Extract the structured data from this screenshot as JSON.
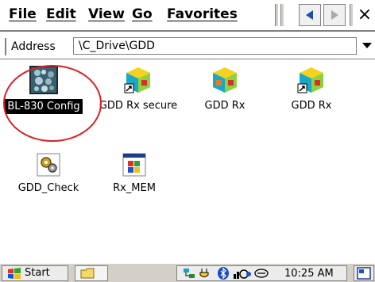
{
  "menubar": {
    "file": "File",
    "edit": "Edit",
    "view": "View",
    "go": "Go",
    "favorites": "Favorites",
    "close_glyph": "×"
  },
  "address": {
    "label": "Address",
    "path": "\\C_Drive\\GDD"
  },
  "files": [
    {
      "label": "BL-830 Config",
      "icon": "config-exe-icon",
      "selected": true
    },
    {
      "label": "GDD Rx secure",
      "icon": "gdd-shortcut-icon"
    },
    {
      "label": "GDD Rx",
      "icon": "gdd-app-icon"
    },
    {
      "label": "GDD Rx",
      "icon": "gdd-shortcut-icon"
    },
    {
      "label": "GDD_Check",
      "icon": "gears-icon"
    },
    {
      "label": "Rx_MEM",
      "icon": "windows-app-icon"
    }
  ],
  "taskbar": {
    "start": "Start",
    "clock": "10:25 AM"
  },
  "colors": {
    "highlight_oval": "#dd1f26",
    "selection": "#000000",
    "chrome": "#d4d0c8"
  }
}
